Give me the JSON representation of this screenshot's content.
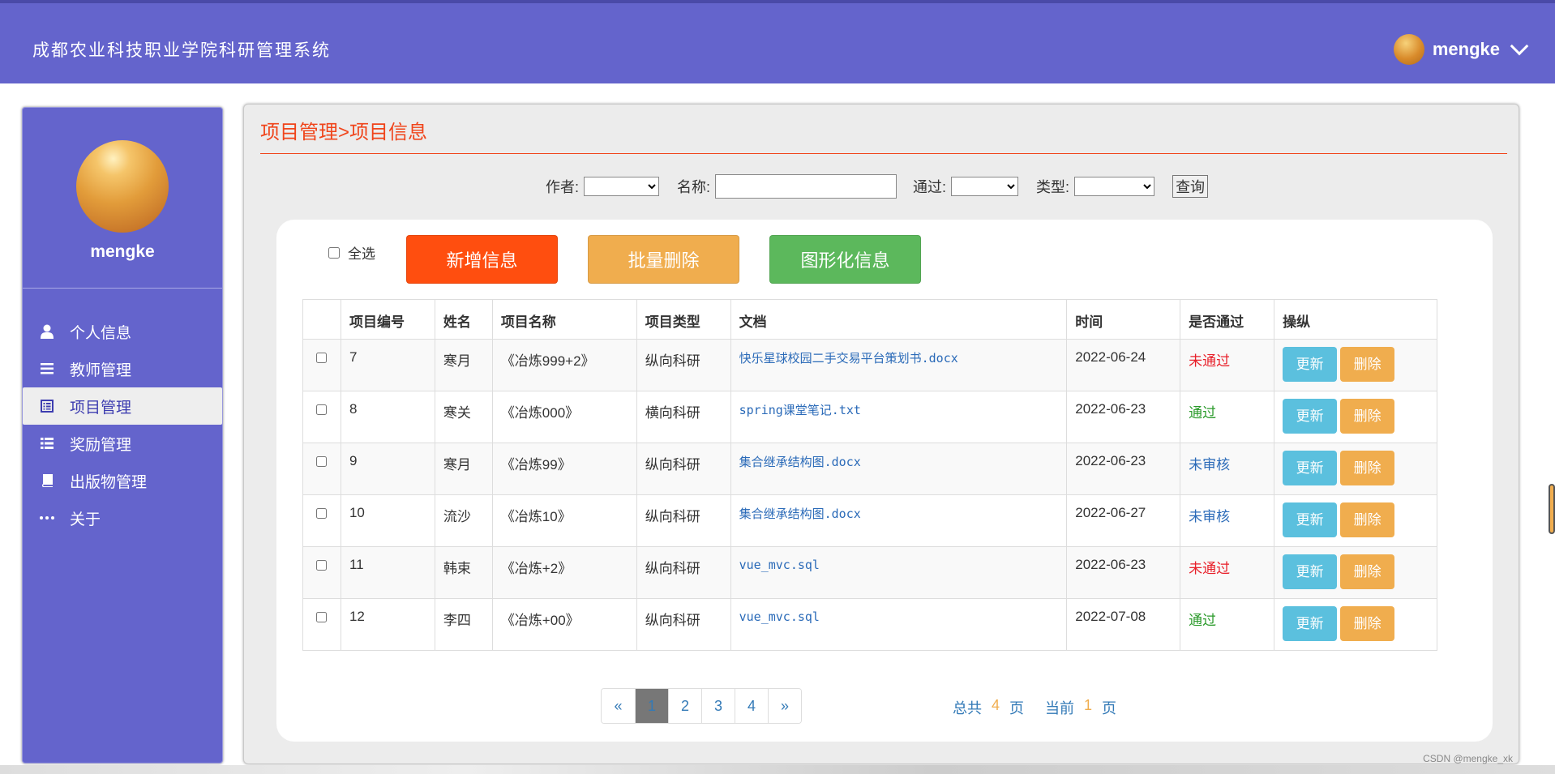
{
  "header": {
    "app_title": "成都农业科技职业学院科研管理系统",
    "username": "mengke"
  },
  "sidebar": {
    "username": "mengke",
    "items": [
      {
        "label": "个人信息",
        "icon": "user-icon"
      },
      {
        "label": "教师管理",
        "icon": "menu-lines-icon"
      },
      {
        "label": "项目管理",
        "icon": "list-alt-icon",
        "active": true
      },
      {
        "label": "奖励管理",
        "icon": "th-list-icon"
      },
      {
        "label": "出版物管理",
        "icon": "book-icon"
      },
      {
        "label": "关于",
        "icon": "more-dots-icon"
      }
    ]
  },
  "main": {
    "breadcrumb": "项目管理>项目信息",
    "filters": {
      "author_label": "作者:",
      "name_label": "名称:",
      "passed_label": "通过:",
      "type_label": "类型:",
      "query_button": "查询"
    },
    "select_all_label": "全选",
    "buttons": {
      "add": "新增信息",
      "batch_delete": "批量删除",
      "chart": "图形化信息"
    },
    "table": {
      "columns": [
        "项目编号",
        "姓名",
        "项目名称",
        "项目类型",
        "文档",
        "时间",
        "是否通过",
        "操纵"
      ],
      "rows": [
        {
          "id": "7",
          "name": "寒月",
          "project": "《冶炼999+2》",
          "type": "纵向科研",
          "doc": "快乐星球校园二手交易平台策划书.docx",
          "date": "2022-06-24",
          "status": "未通过",
          "status_color": "red"
        },
        {
          "id": "8",
          "name": "寒关",
          "project": "《冶炼000》",
          "type": "横向科研",
          "doc": "spring课堂笔记.txt",
          "date": "2022-06-23",
          "status": "通过",
          "status_color": "green"
        },
        {
          "id": "9",
          "name": "寒月",
          "project": "《冶炼99》",
          "type": "纵向科研",
          "doc": "集合继承结构图.docx",
          "date": "2022-06-23",
          "status": "未审核",
          "status_color": "blue"
        },
        {
          "id": "10",
          "name": "流沙",
          "project": "《冶炼10》",
          "type": "纵向科研",
          "doc": "集合继承结构图.docx",
          "date": "2022-06-27",
          "status": "未审核",
          "status_color": "blue"
        },
        {
          "id": "11",
          "name": "韩束",
          "project": "《冶炼+2》",
          "type": "纵向科研",
          "doc": "vue_mvc.sql",
          "date": "2022-06-23",
          "status": "未通过",
          "status_color": "red"
        },
        {
          "id": "12",
          "name": "李四",
          "project": "《冶炼+00》",
          "type": "纵向科研",
          "doc": "vue_mvc.sql",
          "date": "2022-07-08",
          "status": "通过",
          "status_color": "green"
        }
      ],
      "update_label": "更新",
      "delete_label": "删除"
    },
    "pagination": {
      "prev": "«",
      "pages": [
        "1",
        "2",
        "3",
        "4"
      ],
      "next": "»",
      "current": 1,
      "total_label": "总共",
      "total": "4",
      "page_unit": "页",
      "current_label": "当前",
      "current_value": "1"
    }
  },
  "watermark": "CSDN @mengke_xk",
  "colors": {
    "header_bg": "#6464cc",
    "accent_red": "#f0441a",
    "btn_add": "#ff4e0f",
    "btn_batch": "#f0ad4e",
    "btn_chart": "#5cb85c",
    "btn_update": "#5bc0de",
    "btn_delete": "#f0ad4e"
  }
}
